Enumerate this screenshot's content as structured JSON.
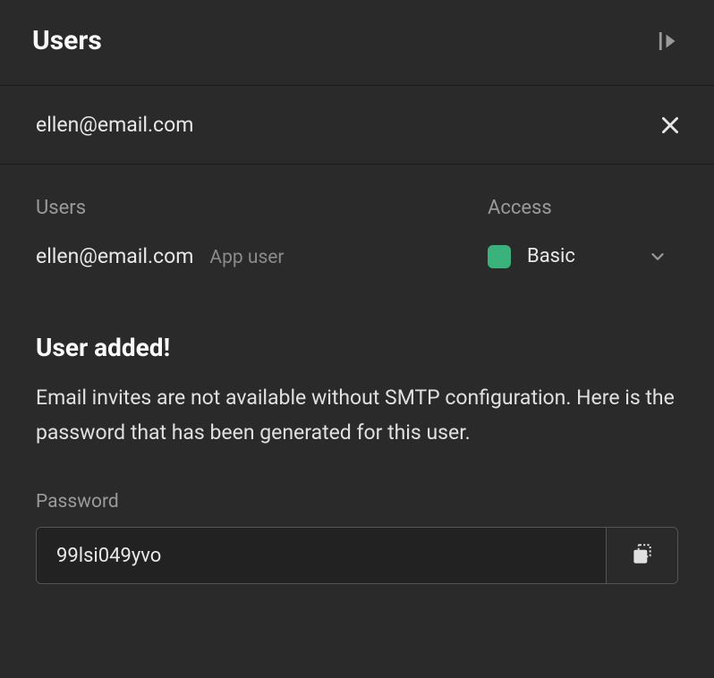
{
  "header": {
    "title": "Users"
  },
  "input": {
    "email": "ellen@email.com"
  },
  "columns": {
    "users": "Users",
    "access": "Access"
  },
  "user": {
    "email": "ellen@email.com",
    "role": "App user",
    "access": "Basic",
    "access_color": "#3ab27b"
  },
  "notice": {
    "title": "User added!",
    "body": "Email invites are not available without SMTP configuration. Here is the password that has been generated for this user."
  },
  "password": {
    "label": "Password",
    "value": "99lsi049yvo"
  }
}
